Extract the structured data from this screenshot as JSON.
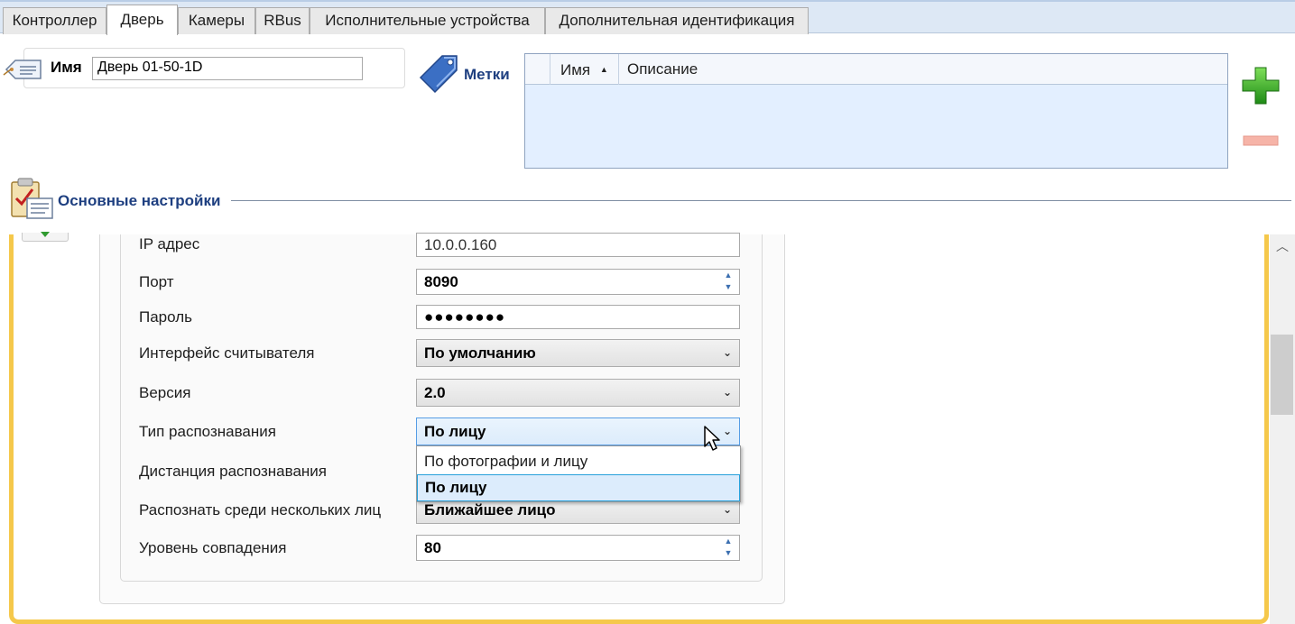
{
  "tabs": [
    {
      "label": "Контроллер",
      "active": false
    },
    {
      "label": "Дверь",
      "active": true
    },
    {
      "label": "Камеры",
      "active": false
    },
    {
      "label": "RBus",
      "active": false
    },
    {
      "label": "Исполнительные устройства",
      "active": false
    },
    {
      "label": "Дополнительная идентификация",
      "active": false
    }
  ],
  "name_panel": {
    "label": "Имя",
    "value": "Дверь 01-50-1D",
    "icon": "name-tag-icon"
  },
  "tags": {
    "label": "Метки",
    "icon": "tag-icon",
    "columns": [
      {
        "label": "Имя",
        "sort": "ascending"
      },
      {
        "label": "Описание"
      }
    ],
    "rows": [],
    "add_icon": "plus-icon",
    "remove_icon": "minus-icon"
  },
  "section": {
    "title": "Основные настройки",
    "icon": "clipboard-checklist-icon"
  },
  "fields": {
    "ip": {
      "label": "IP адрес",
      "value": "10.0.0.160"
    },
    "port": {
      "label": "Порт",
      "value": "8090"
    },
    "password": {
      "label": "Пароль",
      "value": "●●●●●●●●"
    },
    "reader_interface": {
      "label": "Интерфейс считывателя",
      "value": "По умолчанию"
    },
    "version": {
      "label": "Версия",
      "value": "2.0"
    },
    "recognition_type": {
      "label": "Тип распознавания",
      "value": "По лицу",
      "options": [
        "По фотографии и лицу",
        "По лицу"
      ],
      "selected_index": 1
    },
    "recognition_distance": {
      "label": "Дистанция распознавания"
    },
    "multi_face": {
      "label": "Распознать среди нескольких лиц",
      "value": "Ближайшее лицо"
    },
    "match_level": {
      "label": "Уровень совпадения",
      "value": "80"
    }
  },
  "colors": {
    "accent_blue": "#1e3f80",
    "frame_yellow": "#f5c84b",
    "grid_bg": "#e3efff",
    "selected_item": "#dcecfc"
  }
}
